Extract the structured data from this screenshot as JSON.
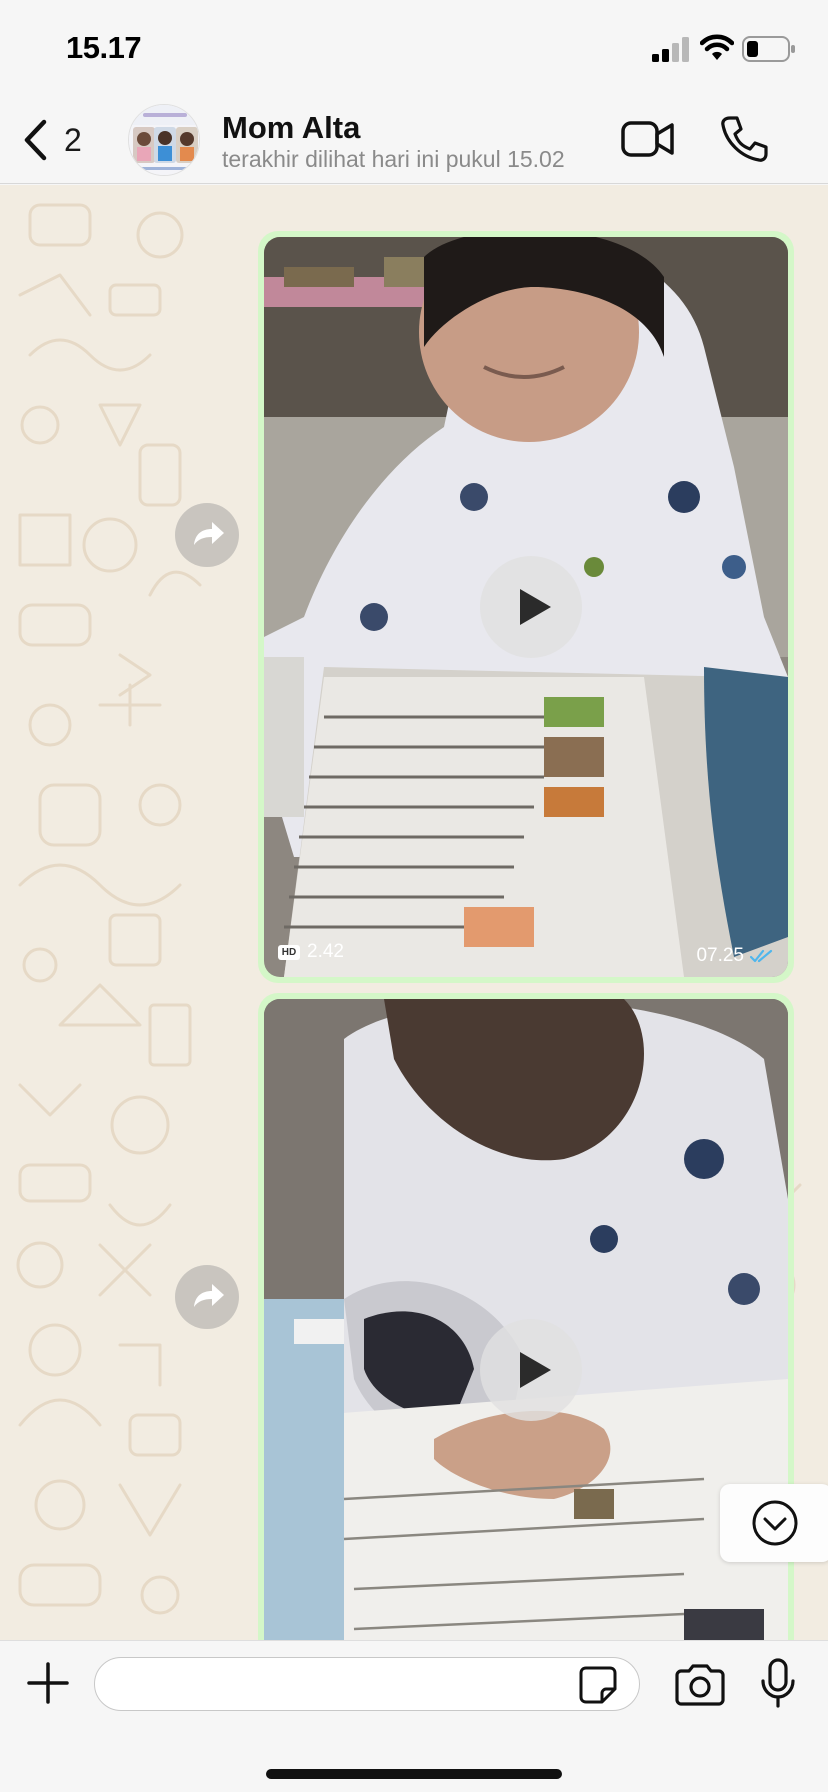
{
  "status_bar": {
    "time": "15.17",
    "icons": [
      "cellular-signal-icon",
      "wifi-icon",
      "battery-icon"
    ]
  },
  "header": {
    "back_count": "2",
    "contact_name": "Mom Alta",
    "last_seen": "terakhir dilihat hari ini pukul 15.02",
    "actions": [
      "video-call-icon",
      "voice-call-icon"
    ]
  },
  "messages": [
    {
      "type": "video",
      "direction": "outgoing",
      "duration": "2.42",
      "quality": "HD",
      "time": "07.25",
      "status": "read"
    },
    {
      "type": "video",
      "direction": "outgoing",
      "duration": "",
      "quality": "",
      "time": "",
      "status": ""
    }
  ],
  "composer": {
    "value": "",
    "placeholder": "",
    "icons": [
      "plus-icon",
      "sticker-icon",
      "camera-icon",
      "microphone-icon"
    ]
  },
  "colors": {
    "bubble_outgoing": "#d4f7c8",
    "read_tick": "#4fb6ec",
    "chat_wallpaper": "#f2ece1",
    "bar_background": "#f6f6f6"
  }
}
